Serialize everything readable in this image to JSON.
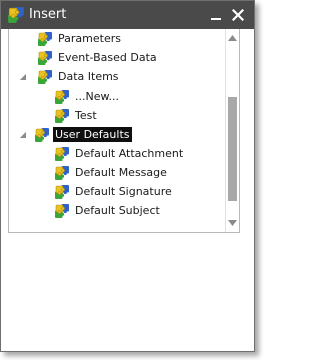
{
  "window": {
    "title": "Insert",
    "title_icon": "puzzle-icon",
    "minimize_icon": "minimize-icon",
    "close_icon": "close-icon"
  },
  "tree": {
    "items": [
      {
        "label": "Parameters",
        "icon": "puzzle-icon"
      },
      {
        "label": "Event-Based Data",
        "icon": "puzzle-icon"
      },
      {
        "label": "Data Items",
        "icon": "puzzle-icon",
        "expanded": true
      },
      {
        "label": "...New...",
        "icon": "puzzle-icon"
      },
      {
        "label": "Test",
        "icon": "puzzle-icon"
      },
      {
        "label": "User Defaults",
        "icon": "puzzle-icon",
        "expanded": true,
        "selected": true
      },
      {
        "label": "Default Attachment",
        "icon": "puzzle-icon"
      },
      {
        "label": "Default Message",
        "icon": "puzzle-icon"
      },
      {
        "label": "Default Signature",
        "icon": "puzzle-icon"
      },
      {
        "label": "Default Subject",
        "icon": "puzzle-icon"
      }
    ]
  },
  "scrollbar": {
    "up_icon": "scroll-up-arrow-icon",
    "down_icon": "scroll-down-arrow-icon"
  },
  "colors": {
    "titlebar": "#4a4a4a",
    "selection": "#0f0f0f",
    "puzzle_yellow": "#e8c322",
    "puzzle_green": "#3aa63a",
    "puzzle_blue": "#2f63c9"
  }
}
